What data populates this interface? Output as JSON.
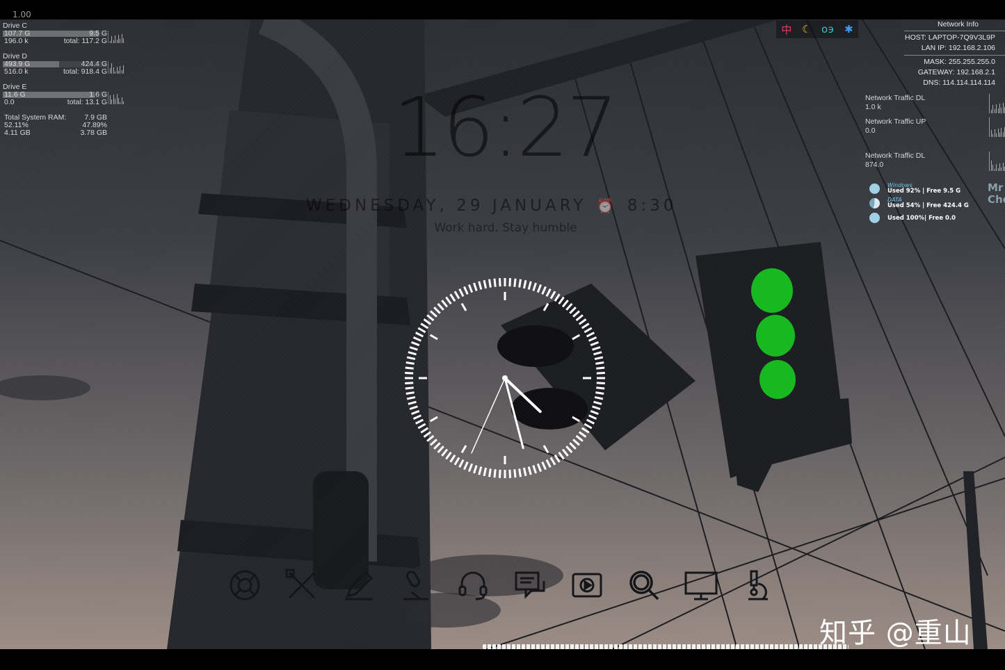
{
  "top_indicator": "1.00",
  "drives": [
    {
      "name": "Drive C",
      "used": "107.7 G",
      "free": "9.5 G",
      "rate": "196.0 k",
      "total": "total: 117.2 G",
      "used_fraction": 0.92
    },
    {
      "name": "Drive D",
      "used": "493.9 G",
      "free": "424.4 G",
      "rate": "516.0 k",
      "total": "total: 918.4 G",
      "used_fraction": 0.54
    },
    {
      "name": "Drive E",
      "used": "11.6 G",
      "free": "1.6 G",
      "rate": "0.0",
      "total": "total: 13.1 G",
      "used_fraction": 0.88
    }
  ],
  "ram": {
    "label": "Total System RAM:",
    "total": "7.9 GB",
    "used_pct": "52.11%",
    "free_pct": "47.89%",
    "used": "4.11 GB",
    "free": "3.78 GB"
  },
  "tray": {
    "icons": [
      "ime-chinese-icon",
      "moon-icon",
      "clipboard-icon",
      "gear-icon"
    ],
    "ime_label": "中",
    "moon": "☾",
    "link": "ο϶",
    "gear": "✱",
    "colors": {
      "ime": "#e0405a",
      "moon": "#f0c020",
      "link": "#30c8c8",
      "gear": "#3c9cf0"
    }
  },
  "network": {
    "title": "Network Info",
    "host": "HOST: LAPTOP-7Q9V3L9P",
    "lan_ip": "LAN IP: 192.168.2.106",
    "mask": "MASK: 255.255.255.0",
    "gateway": "GATEWAY: 192.168.2.1",
    "dns": "DNS: 114.114.114.114"
  },
  "traffic": [
    {
      "label": "Network Traffic DL",
      "value": "1.0 k"
    },
    {
      "label": "Network Traffic UP",
      "value": "0.0"
    },
    {
      "label": "Network Traffic DL",
      "value": "874.0"
    }
  ],
  "disks": [
    {
      "label": "Windows",
      "info": "Used 92%  | Free 9.5 G",
      "used_pct": 92
    },
    {
      "label": "DATA",
      "info": "Used 54%  | Free 424.4 G",
      "used_pct": 54
    },
    {
      "label": "",
      "info": "Used 100%| Free 0.0",
      "used_pct": 100
    }
  ],
  "mr_text": [
    "Mr",
    "Chen"
  ],
  "clock": {
    "time": "16:27",
    "date": "WEDNESDAY, 29 JANUARY",
    "alarm": "8:30",
    "motto": "Work hard. Stay humble",
    "hour": 16,
    "minute": 27,
    "second": 34
  },
  "dock_items": [
    "lifebuoy-icon",
    "tools-icon",
    "pencil-icon",
    "microphone-icon",
    "headset-icon",
    "chat-icon",
    "media-player-icon",
    "search-icon",
    "monitor-icon",
    "microscope-icon"
  ],
  "watermark": "知乎 @重山",
  "colors": {
    "accent": "#6fc8ec",
    "traffic_light_green": "#14d41e"
  }
}
